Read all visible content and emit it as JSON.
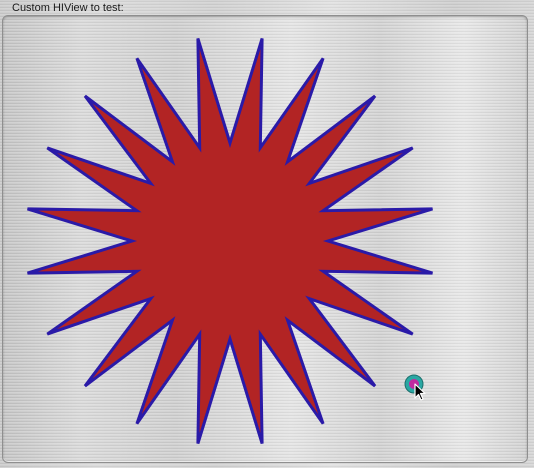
{
  "label": "Custom HIView to test:",
  "view": {
    "star": {
      "points": 20,
      "fill": "#b22424",
      "stroke": "#2a1aa8"
    }
  },
  "cursor": {
    "ring": "#2aa7a3",
    "dot": "#c02aa0"
  }
}
